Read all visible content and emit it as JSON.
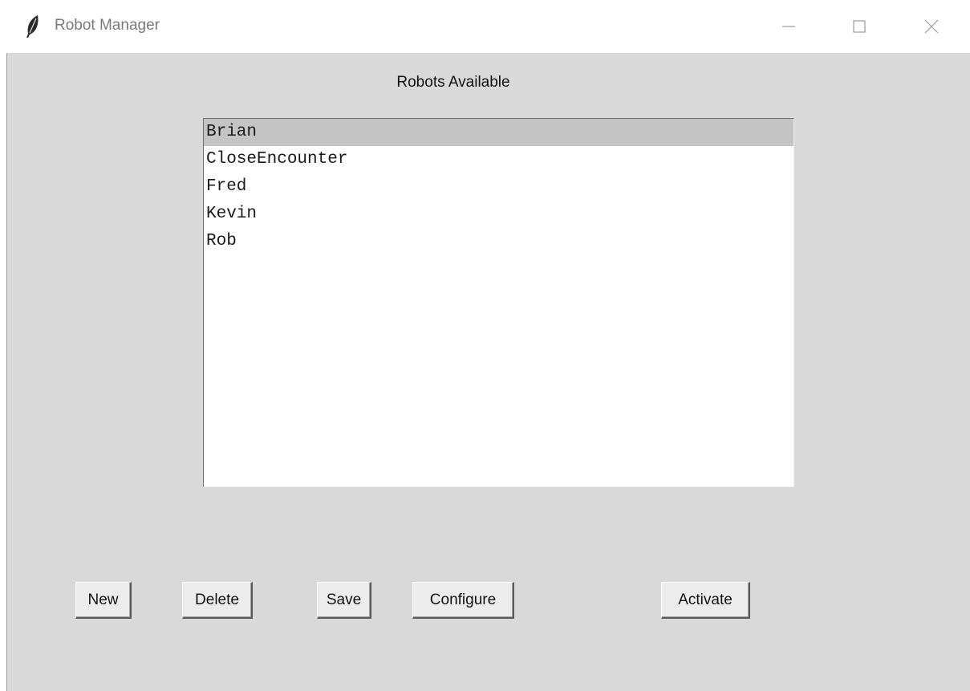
{
  "window": {
    "title": "Robot Manager",
    "controls": {
      "minimize_icon": "minimize-icon",
      "maximize_icon": "maximize-icon",
      "close_icon": "close-icon"
    },
    "app_icon": "feather-icon"
  },
  "main": {
    "list_heading": "Robots Available",
    "robots": [
      {
        "label": "Brian",
        "selected": true
      },
      {
        "label": "CloseEncounter",
        "selected": false
      },
      {
        "label": "Fred",
        "selected": false
      },
      {
        "label": "Kevin",
        "selected": false
      },
      {
        "label": "Rob",
        "selected": false
      }
    ]
  },
  "buttons": {
    "new_label": "New",
    "delete_label": "Delete",
    "save_label": "Save",
    "configure_label": "Configure",
    "activate_label": "Activate"
  },
  "colors": {
    "window_bg": "#d9d9d9",
    "selection_bg": "#c4c4c4",
    "list_bg": "#ffffff"
  }
}
